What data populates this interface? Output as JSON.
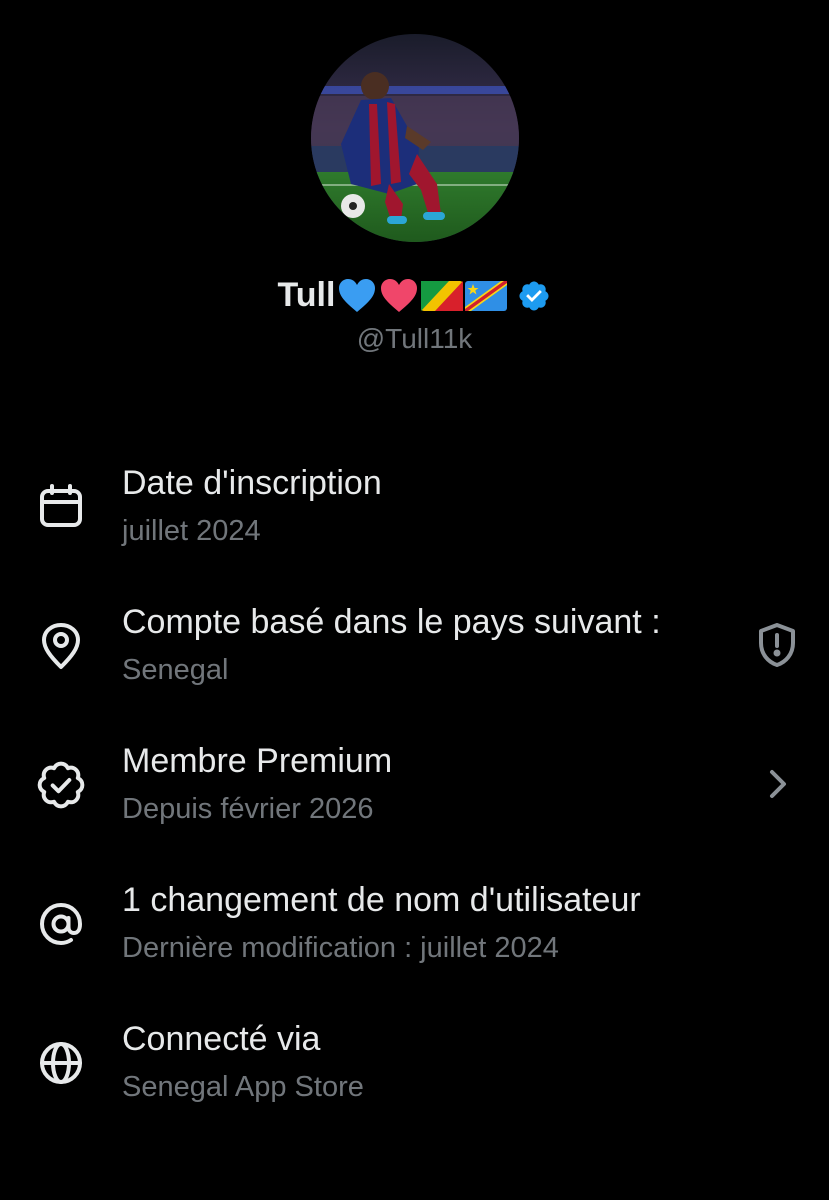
{
  "profile": {
    "display_name": "Tull",
    "name_emojis": [
      "blue-heart",
      "red-heart",
      "congo-flag",
      "drc-flag"
    ],
    "handle": "@Tull11k",
    "verified": true,
    "avatar_description": "footballer-photo"
  },
  "info": [
    {
      "icon": "calendar-icon",
      "title": "Date d'inscription",
      "subtitle": "juillet 2024"
    },
    {
      "icon": "location-pin-icon",
      "title": "Compte basé dans le pays suivant :",
      "subtitle": "Senegal",
      "trailing_icon": "shield-alert-icon"
    },
    {
      "icon": "verified-badge-outline-icon",
      "title": "Membre Premium",
      "subtitle": "Depuis février 2026",
      "trailing_icon": "chevron-right-icon"
    },
    {
      "icon": "at-sign-icon",
      "title": "1 changement de nom d'utilisateur",
      "subtitle": "Dernière modification : juillet 2024"
    },
    {
      "icon": "globe-icon",
      "title": "Connecté via",
      "subtitle": "Senegal App Store"
    }
  ],
  "colors": {
    "background": "#000000",
    "primary_text": "#e7e9ea",
    "secondary_text": "#71767b",
    "verified_blue": "#1d9bf0"
  }
}
